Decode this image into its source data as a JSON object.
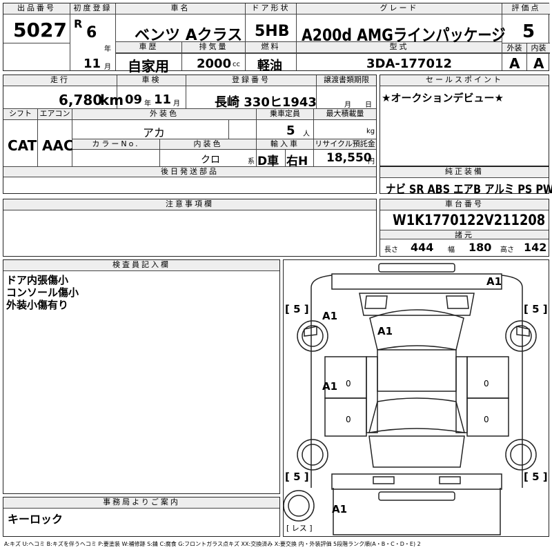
{
  "header": {
    "lot_label": "出品番号",
    "lot_no": "5027",
    "first_reg_label": "初度登録",
    "era": "R",
    "year_val": "6",
    "year_unit": "年",
    "month_val": "11",
    "month_unit": "月",
    "car_name_label": "車名",
    "car_name": "ベンツ Aクラス",
    "history_label": "車歴",
    "history": "自家用",
    "displacement_label": "排気量",
    "displacement": "2000",
    "displacement_unit": "cc",
    "door_label": "ドア形状",
    "door": "5HB",
    "fuel_label": "燃料",
    "fuel": "軽油",
    "grade_label": "グレード",
    "grade": "A200d AMGラインパッケージ",
    "model_label": "型式",
    "model": "3DA-177012",
    "score_label": "評価点",
    "score": "5",
    "ext_label": "外装",
    "ext": "A",
    "int_label": "内装",
    "int": "A"
  },
  "row2": {
    "mileage_label": "走行",
    "mileage": "6,780",
    "mileage_unit": "km",
    "inspection_label": "車検",
    "insp_year": "09",
    "insp_year_unit": "年",
    "insp_month": "11",
    "insp_month_unit": "月",
    "plate_label": "登録番号",
    "plate": "長崎 330ヒ1943",
    "transfer_label": "譲渡書類期限",
    "transfer_month": "月",
    "transfer_day": "日",
    "shift_label": "シフト",
    "shift": "CAT",
    "ac_label": "エアコン",
    "ac": "AAC",
    "ext_color_label": "外装色",
    "ext_color": "アカ",
    "capacity_label": "乗車定員",
    "capacity": "5",
    "capacity_unit": "人",
    "max_load_label": "最大積載量",
    "max_load_unit": "kg",
    "color_no_label": "カラーNo.",
    "int_color_label": "内装色",
    "int_color": "クロ",
    "int_color_suffix": "系",
    "import_label": "輸入車",
    "import_val": "D車",
    "steering": "右H",
    "recycle_label": "リサイクル預託金",
    "recycle": "18,550",
    "recycle_unit": "円",
    "later_parts_label": "後日発送部品"
  },
  "sales_point": {
    "label": "セールスポイント",
    "text": "★オークションデビュー★"
  },
  "equipment": {
    "label": "純正装備",
    "items": "ナビ SR ABS エアB アルミ PS PW"
  },
  "notes": {
    "label": "注意事項欄"
  },
  "chassis": {
    "label": "車台番号",
    "number": "W1K1770122V211208",
    "spec_label": "諸元",
    "length_label": "長さ",
    "length": "444",
    "width_label": "幅",
    "width": "180",
    "height_label": "高さ",
    "height": "142"
  },
  "inspector": {
    "label": "検査員記入欄",
    "line1": "ドア内張傷小",
    "line2": "コンソール傷小",
    "line3": "外装小傷有り"
  },
  "office": {
    "label": "事務局よりご案内",
    "text": "キーロック"
  },
  "diagram": {
    "tire_fl": "[ 5 ]",
    "tire_fr": "[ 5 ]",
    "tire_rl": "[ 5 ]",
    "tire_rr": "[ 5 ]",
    "mark_front": "A1",
    "mark_fender": "A1",
    "mark_hood": "A1",
    "mark_door": "A1",
    "mark_rear": "A1",
    "zero": "0",
    "spare": "[ レス ]"
  },
  "legend": "A:キズ U:ヘコミ B:キズを伴うヘコミ P:要塗装 W:補修跡 S:錆 C:腐食 G:フロントガラス点キズ XX:交換済み X:要交換 内・外装評価 5段階ランク順(A・B・C・D・E) 2"
}
